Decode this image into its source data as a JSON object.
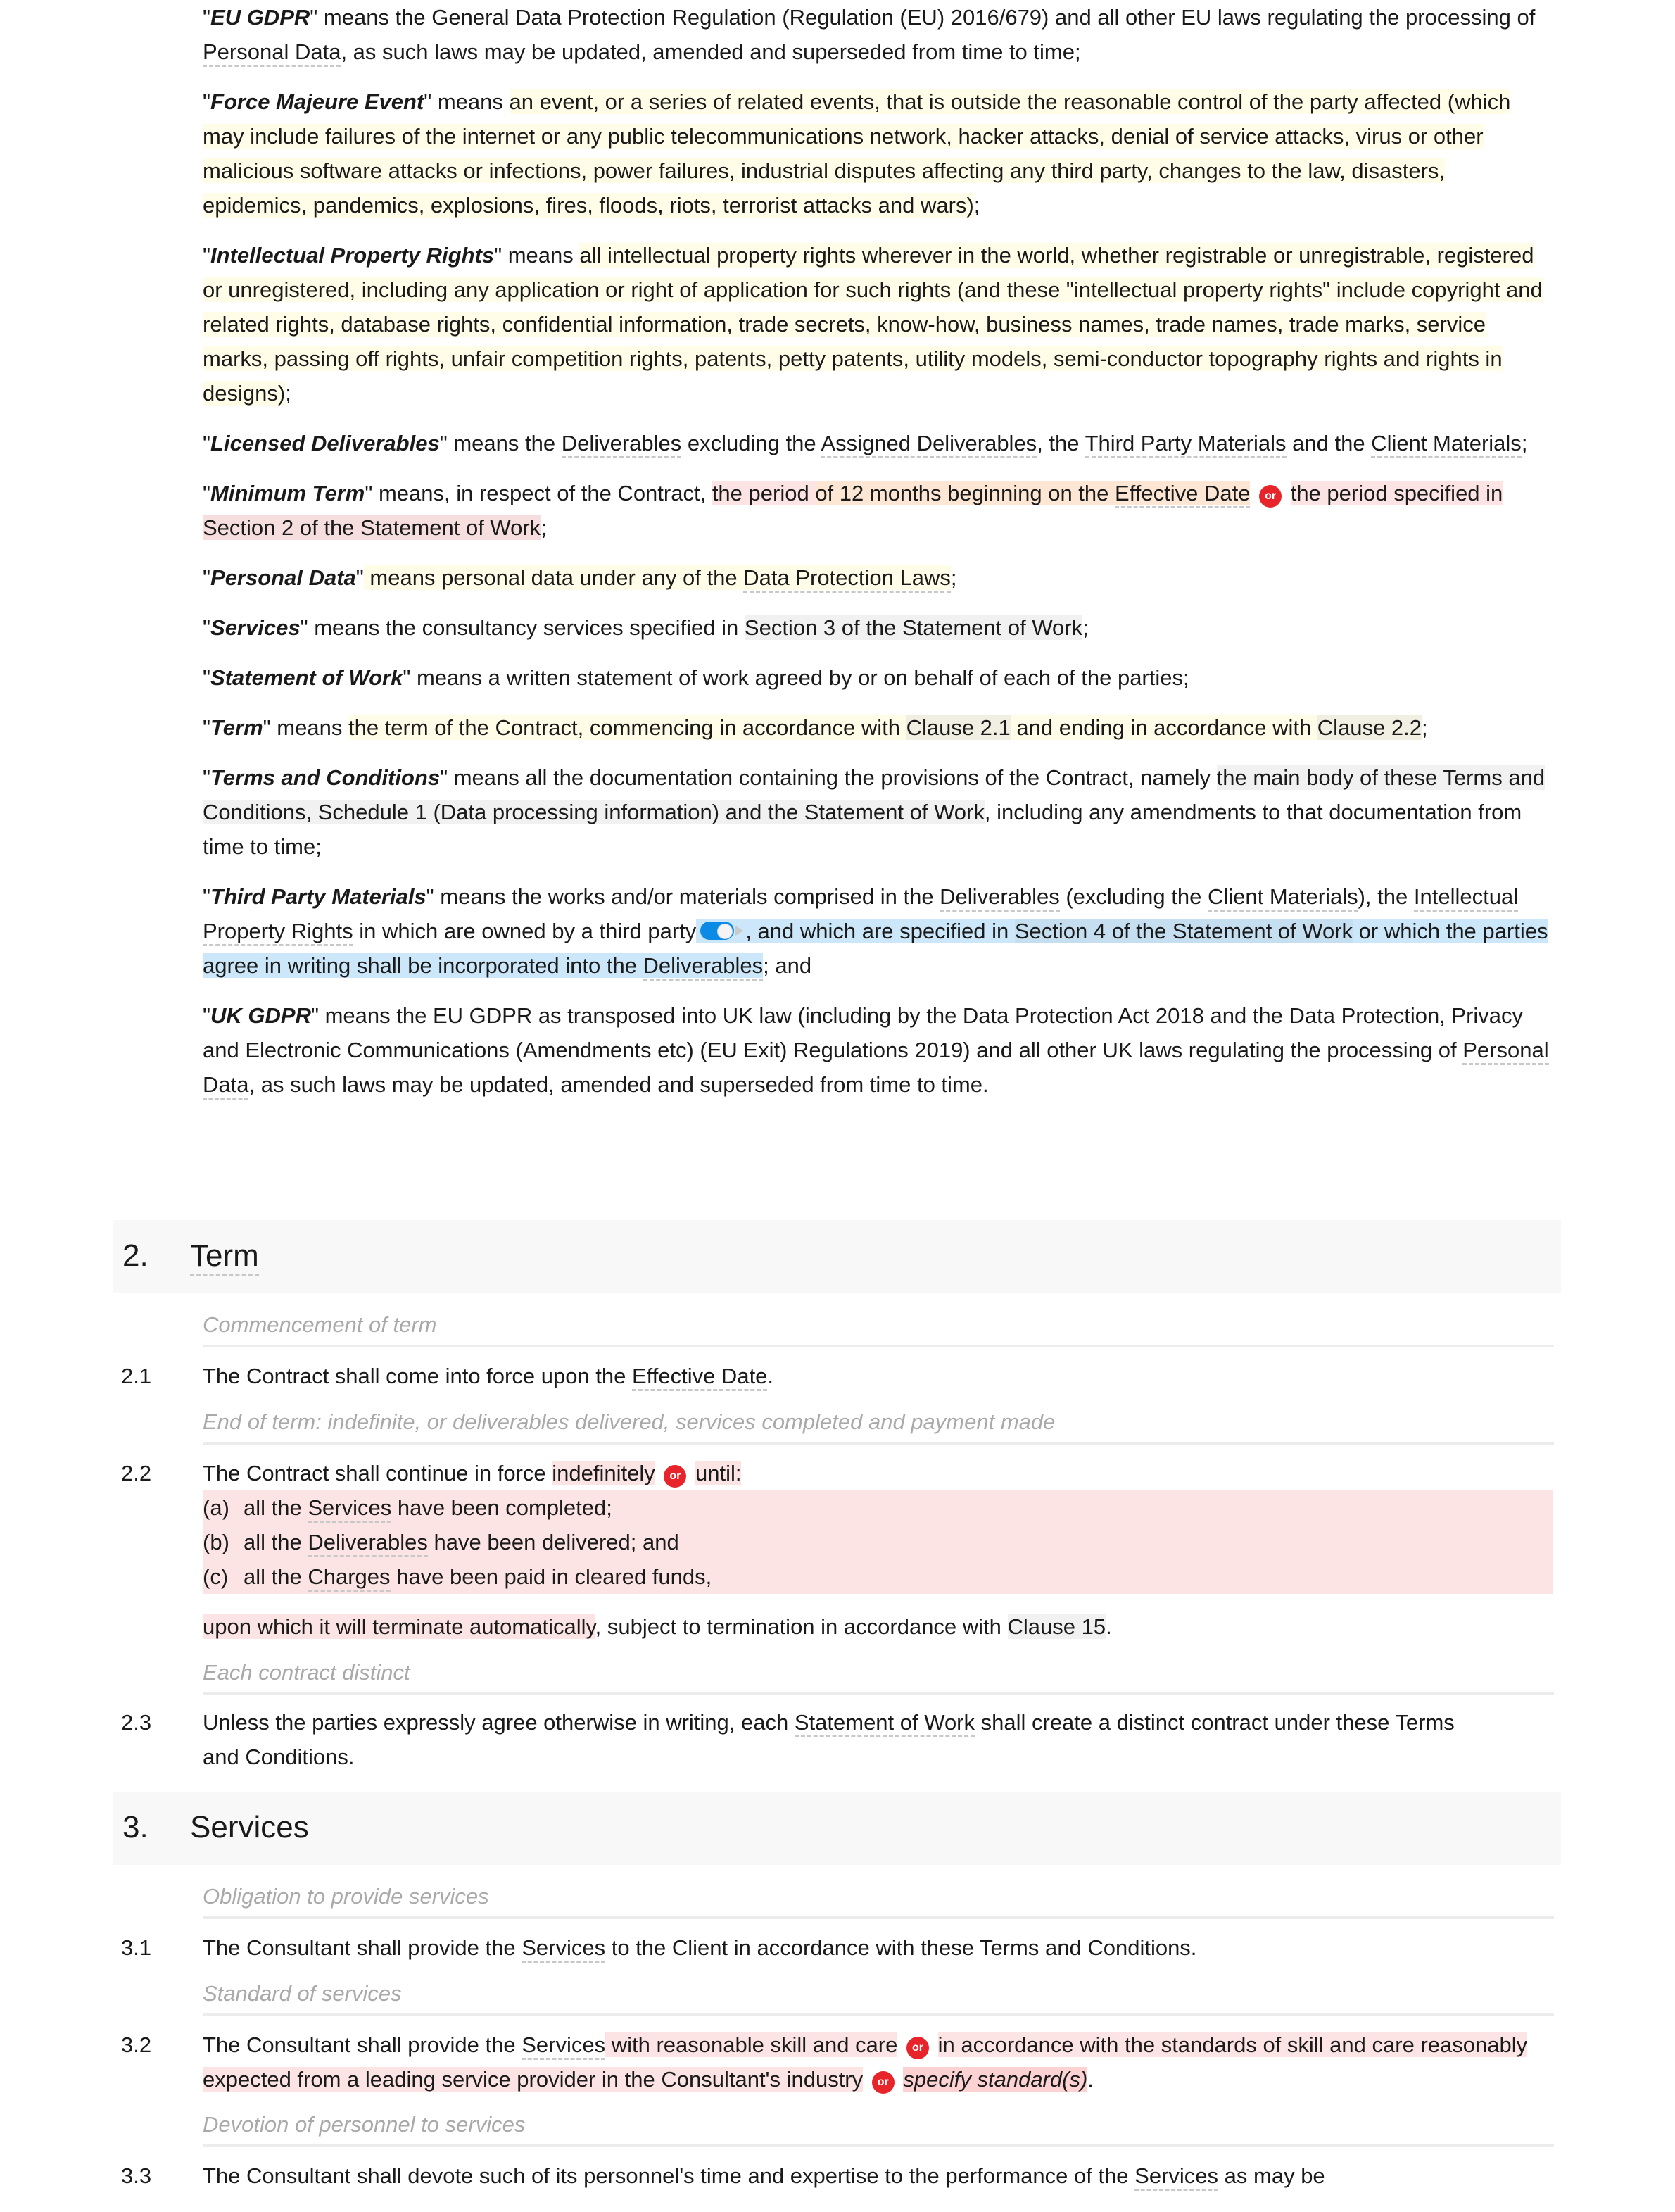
{
  "definitions": {
    "eu_gdpr": {
      "term": "EU GDPR",
      "text_1": " means the General Data Protection Regulation (Regulation (EU) 2016/679) and all other EU laws regulating the processing of ",
      "ref_personal_data": "Personal Data",
      "text_2": ", as such laws may be updated, amended and superseded from time to time;"
    },
    "force_majeure": {
      "term": "Force Majeure Event",
      "means": " means ",
      "body": "an event, or a series of related events, that is outside the reasonable control of the party affected (which may include failures of the internet or any public telecommunications network, hacker attacks, denial of service attacks, virus or other malicious software attacks or infections, power failures, industrial disputes affecting any third party, changes to the law, disasters, epidemics, pandemics, explosions, fires, floods, riots, terrorist attacks and wars)",
      "end": ";"
    },
    "ipr": {
      "term": "Intellectual Property Rights",
      "means": " means ",
      "body": "all intellectual property rights wherever in the world, whether registrable or unregistrable, registered or unregistered, including any application or right of application for such rights (and these \"intellectual property rights\" include copyright and related rights, database rights, confidential information, trade secrets, know-how, business names, trade names, trade marks, service marks, passing off rights, unfair competition rights, patents, petty patents, utility models, semi-conductor topography rights and rights in designs)",
      "end": ";"
    },
    "licensed_deliverables": {
      "term": "Licensed Deliverables",
      "text_1": " means the ",
      "ref_deliverables": "Deliverables",
      "text_2": " excluding the ",
      "ref_assigned": "Assigned Deliverables",
      "text_3": ", the ",
      "ref_third_party": "Third Party Materials",
      "text_4": " and the ",
      "ref_client_materials": "Client Materials",
      "text_5": ";"
    },
    "minimum_term": {
      "term": "Minimum Term",
      "text_1": " means, in respect of the Contract, ",
      "opt_a_prefix": "the period ",
      "opt_a_body": "of 12 months beginning on the ",
      "ref_effective_date": "Effective Date",
      "or_label": "or",
      "opt_b_1": "the period specified in ",
      "opt_b_ref": "Section 2 of the Statement of Work",
      "end": ";"
    },
    "personal_data": {
      "term": "Personal Data",
      "body": " means personal data under any of the ",
      "ref_dpl": "Data Protection Laws",
      "end": ";"
    },
    "services": {
      "term": "Services",
      "text_1": " means the consultancy services specified in ",
      "ref_section": "Section 3 of the Statement of Work",
      "end": ";"
    },
    "sow": {
      "term": "Statement of Work",
      "text_1": " means a written statement of work agreed by or on behalf of each of the parties;"
    },
    "term_def": {
      "term": "Term",
      "means": " means ",
      "body_1": "the term of the Contract, commencing in accordance with ",
      "ref_clause_21": "Clause 2.1",
      "body_2": " and ending in accordance with ",
      "ref_clause_22": "Clause 2.2",
      "end": ";"
    },
    "terms_conditions": {
      "term": "Terms and Conditions",
      "text_1": " means all the documentation containing the provisions of the Contract, namely ",
      "hl": "the main body of these Terms and Conditions, Schedule 1 (Data processing information) and the Statement of Work",
      "text_2": ", including any amendments to that documentation from time to time;"
    },
    "third_party_materials": {
      "term": "Third Party Materials",
      "text_1": " means the works and/or materials comprised in the ",
      "ref_deliverables": "Deliverables",
      "text_2": " (excluding the ",
      "ref_client_materials": "Client Materials",
      "text_3": "), the ",
      "ref_ipr": "Intellectual Property Rights",
      "text_4": " in which are owned by a third party",
      "toggle_state": "on",
      "opt_1": ", and which are specified in ",
      "opt_ref": "Section 4 of the Statement of Work",
      "opt_2": " or which the parties agree in writing shall be incorporated into the ",
      "ref_deliverables_2": "Deliverables",
      "end": "; and"
    },
    "uk_gdpr": {
      "term": "UK GDPR",
      "text_1": " means the EU GDPR as transposed into UK law (including by the Data Protection Act 2018 and the Data Protection, Privacy and Electronic Communications (Amendments etc) (EU Exit) Regulations 2019) and all other UK laws regulating the processing of ",
      "ref_personal_data": "Personal Data",
      "text_2": ", as such laws may be updated, amended and superseded from time to time."
    }
  },
  "sections": [
    {
      "number": "2.",
      "title": "Term",
      "clauses": [
        {
          "caption": "Commencement of term",
          "number": "2.1",
          "text_1": "The Contract shall come into force upon the ",
          "ref": "Effective Date",
          "text_2": "."
        },
        {
          "caption": "End of term: indefinite, or deliverables delivered, services completed and payment made",
          "number": "2.2",
          "text_1": "The Contract shall continue in force ",
          "opt_a": "indefinitely",
          "or_label": "or",
          "opt_b": "until:",
          "items": [
            {
              "label": "(a)",
              "pre": "all the ",
              "ref": "Services",
              "post": " have been completed;"
            },
            {
              "label": "(b)",
              "pre": "all the ",
              "ref": "Deliverables",
              "post": " have been delivered; and"
            },
            {
              "label": "(c)",
              "pre": "all the ",
              "ref": "Charges",
              "post": " have been paid in cleared funds,"
            }
          ],
          "tail_hl": "upon which it will terminate automatically",
          "tail_text": ", subject to termination in accordance with ",
          "tail_ref": "Clause 15",
          "tail_end": "."
        },
        {
          "caption": "Each contract distinct",
          "number": "2.3",
          "text_1": "Unless the parties expressly agree otherwise in writing, each ",
          "ref": "Statement of Work",
          "text_2": " shall create a distinct contract under these Terms and Conditions."
        }
      ]
    },
    {
      "number": "3.",
      "title": "Services",
      "clauses": [
        {
          "caption": "Obligation to provide services",
          "number": "3.1",
          "text_1": "The Consultant shall provide the ",
          "ref": "Services",
          "text_2": " to the Client in accordance with these Terms and Conditions."
        },
        {
          "caption": "Standard of services",
          "number": "3.2",
          "text_1": "The Consultant shall provide the ",
          "ref": "Services",
          "opt_a": " with reasonable skill and care",
          "or_label": "or",
          "opt_b": "in accordance with the standards of skill and care reasonably expected from a leading service provider in the Consultant's industry",
          "opt_c": "specify standard(s)",
          "end": "."
        },
        {
          "caption": "Devotion of personnel to services",
          "number": "3.3",
          "text_1": "The Consultant shall devote such of its personnel's time and expertise to the performance of the ",
          "ref": "Services",
          "text_2": " as may be"
        }
      ]
    }
  ]
}
